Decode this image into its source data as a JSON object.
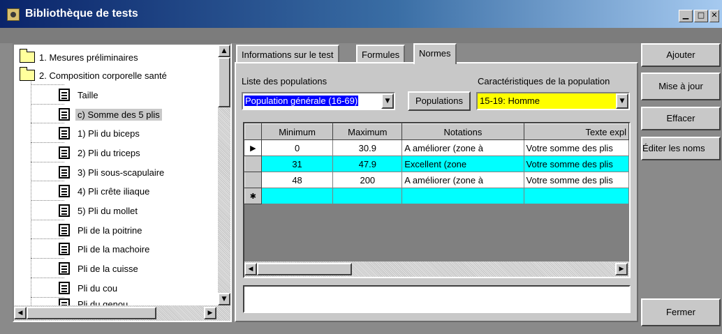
{
  "window": {
    "title": "Bibliothèque de tests",
    "controls": {
      "minimize": "▁",
      "maximize": "□",
      "close": "✕"
    }
  },
  "tree": {
    "folders": [
      {
        "label": "1. Mesures préliminaires",
        "icon": "folder-closed-icon"
      },
      {
        "label": "2. Composition corporelle santé",
        "icon": "folder-open-icon"
      }
    ],
    "items": [
      {
        "label": "Taille"
      },
      {
        "label": "c) Somme des 5 plis",
        "selected": true
      },
      {
        "label": "1) Pli du biceps"
      },
      {
        "label": "2) Pli du triceps"
      },
      {
        "label": "3) Pli sous-scapulaire"
      },
      {
        "label": "4) Pli crête iliaque"
      },
      {
        "label": "5) Pli du mollet"
      },
      {
        "label": "Pli de la poitrine"
      },
      {
        "label": "Pli de la machoire"
      },
      {
        "label": "Pli de la cuisse"
      },
      {
        "label": "Pli du cou"
      },
      {
        "label": "Pli du genou"
      }
    ]
  },
  "tabs": [
    {
      "label": "Informations sur le test"
    },
    {
      "label": "Formules"
    },
    {
      "label": "Normes",
      "active": true
    }
  ],
  "normes": {
    "populations_label": "Liste des populations",
    "population_value": "Population générale (16-69)",
    "populations_button": "Populations",
    "caracteristiques_label": "Caractéristiques de la population",
    "caracteristiques_value": "15-19: Homme",
    "grid": {
      "columns": [
        "Minimum",
        "Maximum",
        "Notations",
        "Texte expl"
      ],
      "rows": [
        {
          "minimum": "0",
          "maximum": "30.9",
          "notation": "A améliorer (zone à",
          "texte": "Votre somme des plis",
          "current": true,
          "color": "white"
        },
        {
          "minimum": "31",
          "maximum": "47.9",
          "notation": "Excellent (zone",
          "texte": "Votre somme des plis",
          "color": "cyan"
        },
        {
          "minimum": "48",
          "maximum": "200",
          "notation": "A améliorer (zone à",
          "texte": "Votre somme des plis",
          "color": "white"
        }
      ],
      "current_marker": "▶",
      "new_row_marker": "✱"
    }
  },
  "actions": {
    "ajouter": "Ajouter",
    "mise_a_jour": "Mise à jour",
    "effacer": "Effacer",
    "editer_noms": "Éditer les noms",
    "fermer": "Fermer"
  },
  "colors": {
    "highlight_cyan": "#00ffff",
    "combo_yellow": "#ffff00",
    "combo_selection": "#0000ff"
  }
}
